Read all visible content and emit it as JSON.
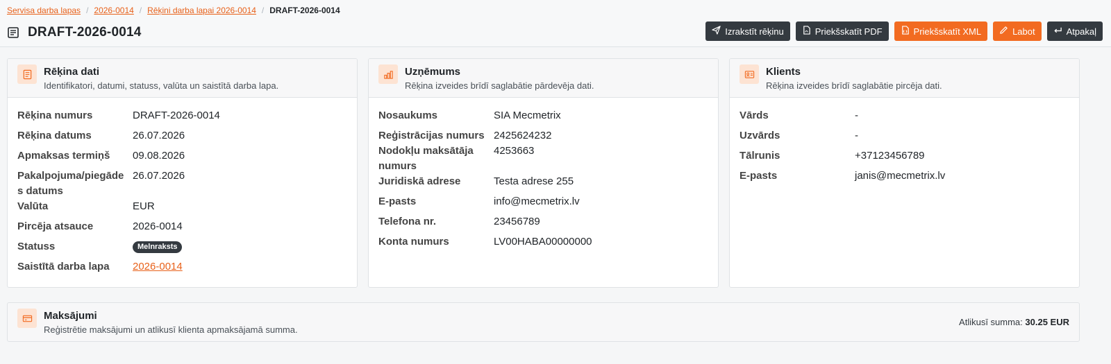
{
  "breadcrumb": {
    "items": [
      "Servisa darba lapas",
      "2026-0014",
      "Rēķini darba lapai 2026-0014"
    ],
    "current": "DRAFT-2026-0014"
  },
  "page": {
    "title": "DRAFT-2026-0014"
  },
  "actions": {
    "issue": "Izrakstīt rēķinu",
    "preview_pdf": "Priekšskatīt PDF",
    "preview_xml": "Priekšskatīt XML",
    "edit": "Labot",
    "back": "Atpakaļ"
  },
  "invoice": {
    "title": "Rēķina dati",
    "subtitle": "Identifikatori, datumi, statuss, valūta un saistītā darba lapa.",
    "rows": [
      {
        "label": "Rēķina numurs",
        "value": "DRAFT-2026-0014"
      },
      {
        "label": "Rēķina datums",
        "value": "26.07.2026"
      },
      {
        "label": "Apmaksas termiņš",
        "value": "09.08.2026"
      },
      {
        "label": "Pakalpojuma/piegādes datums",
        "value": "26.07.2026"
      },
      {
        "label": "Valūta",
        "value": "EUR"
      },
      {
        "label": "Pircēja atsauce",
        "value": "2026-0014"
      },
      {
        "label": "Statuss",
        "value": "Melnraksts"
      },
      {
        "label": "Saistītā darba lapa",
        "value": "2026-0014"
      }
    ]
  },
  "company": {
    "title": "Uzņēmums",
    "subtitle": "Rēķina izveides brīdī saglabātie pārdevēja dati.",
    "rows": [
      {
        "label": "Nosaukums",
        "value": "SIA Mecmetrix"
      },
      {
        "label": "Reģistrācijas numurs",
        "value": "2425624232"
      },
      {
        "label": "Nodokļu maksātāja numurs",
        "value": "4253663"
      },
      {
        "label": "Juridiskā adrese",
        "value": "Testa adrese 255"
      },
      {
        "label": "E-pasts",
        "value": "info@mecmetrix.lv"
      },
      {
        "label": "Telefona nr.",
        "value": "23456789"
      },
      {
        "label": "Konta numurs",
        "value": "LV00HABA00000000"
      }
    ]
  },
  "client": {
    "title": "Klients",
    "subtitle": "Rēķina izveides brīdī saglabātie pircēja dati.",
    "rows": [
      {
        "label": "Vārds",
        "value": "-"
      },
      {
        "label": "Uzvārds",
        "value": "-"
      },
      {
        "label": "Tālrunis",
        "value": "+37123456789"
      },
      {
        "label": "E-pasts",
        "value": "janis@mecmetrix.lv"
      }
    ]
  },
  "payments": {
    "title": "Maksājumi",
    "subtitle": "Reģistrētie maksājumi un atlikusī klienta apmaksājamā summa.",
    "remaining_label": "Atlikusī summa:",
    "remaining_value": "30.25 EUR"
  },
  "colors": {
    "accent": "#f26b21",
    "dark": "#343a40",
    "icon_bg": "#fde3d3"
  },
  "icons": {
    "title": "document-icon",
    "issue": "send-icon",
    "pdf": "pdf-file-icon",
    "xml": "xml-file-icon",
    "edit": "pencil-icon",
    "back": "return-arrow-icon",
    "invoice": "invoice-icon",
    "company": "bar-chart-icon",
    "client": "id-card-icon",
    "payments": "credit-card-icon"
  }
}
